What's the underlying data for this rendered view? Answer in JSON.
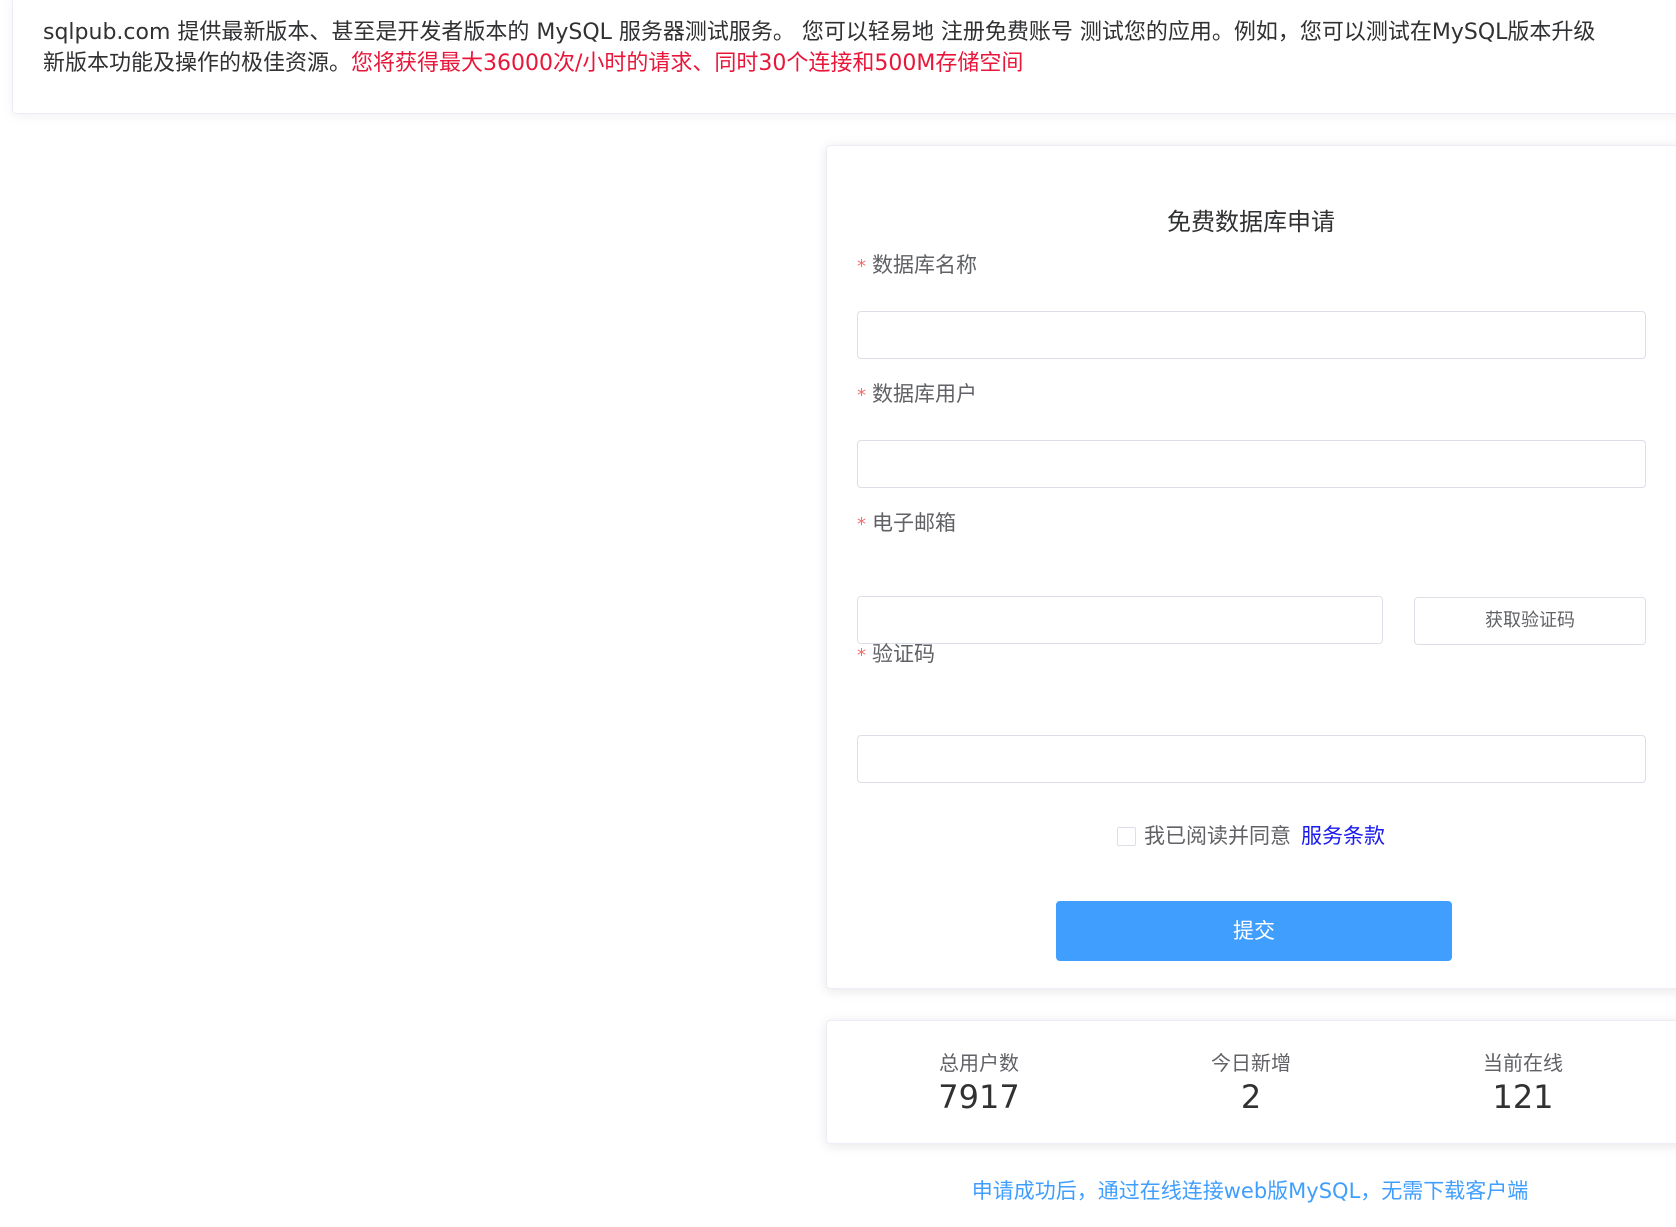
{
  "intro": {
    "line1": "sqlpub.com 提供最新版本、甚至是开发者版本的 MySQL 服务器测试服务。 您可以轻易地 注册免费账号 测试您的应用。例如，您可以测试在MySQL版本升级",
    "line2_prefix": "新版本功能及操作的极佳资源。",
    "line2_highlight": "您将获得最大36000次/小时的请求、同时30个连接和500M存储空间"
  },
  "form": {
    "title": "免费数据库申请",
    "required_mark": "*",
    "db_name_label": "数据库名称",
    "db_user_label": "数据库用户",
    "email_label": "电子邮箱",
    "code_label": "验证码",
    "get_code_button": "获取验证码",
    "agree_text": "我已阅读并同意",
    "terms_link": "服务条款",
    "submit_button": "提交",
    "db_name_value": "",
    "db_user_value": "",
    "email_value": "",
    "code_value": ""
  },
  "stats": {
    "total_users_label": "总用户数",
    "total_users_value": "7917",
    "today_new_label": "今日新增",
    "today_new_value": "2",
    "online_label": "当前在线",
    "online_value": "121"
  },
  "footer": {
    "note": "申请成功后，通过在线连接web版MySQL，无需下载客户端"
  },
  "colors": {
    "primary": "#409eff",
    "highlight_red": "#e8173a",
    "required_red": "#f56c6c",
    "link_blue": "#1a1aed"
  }
}
